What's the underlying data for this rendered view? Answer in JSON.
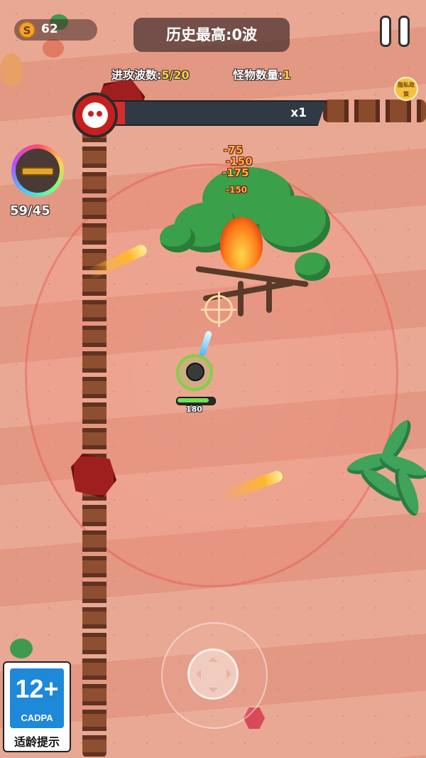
{
  "hud": {
    "coins": "62",
    "coin_symbol": "S",
    "best_record": "历史最高:0波",
    "wave_label": "进攻波数:",
    "wave_value": "5/20",
    "monster_label": "怪物数量:",
    "monster_value": "1",
    "privacy_label": "隐私政策"
  },
  "boss": {
    "multiplier": "x1",
    "health_fraction": 0.08
  },
  "weapon": {
    "ammo": "59/45"
  },
  "player": {
    "hp": "180",
    "hp_fraction": 0.85
  },
  "damage_numbers": [
    "-75",
    "-150",
    "-175",
    "-150"
  ],
  "rating": {
    "age": "12+",
    "org": "CADPA",
    "label": "适龄提示"
  },
  "icons": [
    "coin-icon",
    "pause-icon",
    "boss-demon-icon",
    "weapon-gun-icon",
    "joystick-icon"
  ],
  "colors": {
    "boss_red": "#d72c2c",
    "hp_green": "#6fe05a",
    "gold": "#f5d645",
    "rating_blue": "#1e88d9"
  }
}
